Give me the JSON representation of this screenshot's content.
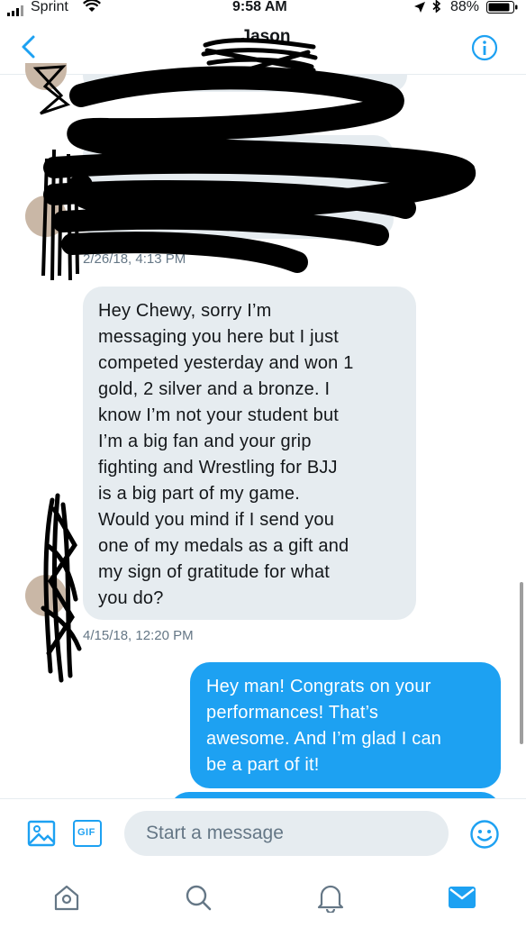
{
  "status_bar": {
    "carrier": "Sprint",
    "time": "9:58 AM",
    "battery": "88%"
  },
  "header": {
    "title": "Jason"
  },
  "messages": [
    {
      "direction": "incoming",
      "text": "Hey Chewy, sorry I’m\nmessaging you here but I just\ncompeted yesterday and won 1\ngold, 2 silver and a bronze. I\nknow I’m not your student but\nI’m a big fan and your grip\nfighting and Wrestling for BJJ\nis a big part of my game.\nWould you mind if I send you\none of my medals as a gift and\nmy sign of gratitude for what\nyou do?",
      "timestamp": "4/15/18, 12:20 PM"
    },
    {
      "direction": "outgoing",
      "text": "Hey man! Congrats on your\nperformances! That’s\nawesome. And I’m glad I can\nbe a part of it!"
    }
  ],
  "earlier_timestamp": "2/26/18, 4:13 PM",
  "composer": {
    "placeholder": "Start a message",
    "gif_label": "GIF"
  },
  "colors": {
    "accent": "#1da1f2",
    "incoming_bubble": "#e6ecf0",
    "muted_text": "#657786"
  },
  "tabs": [
    "home-icon",
    "search-icon",
    "notifications-icon",
    "messages-icon"
  ],
  "active_tab": "messages-icon"
}
